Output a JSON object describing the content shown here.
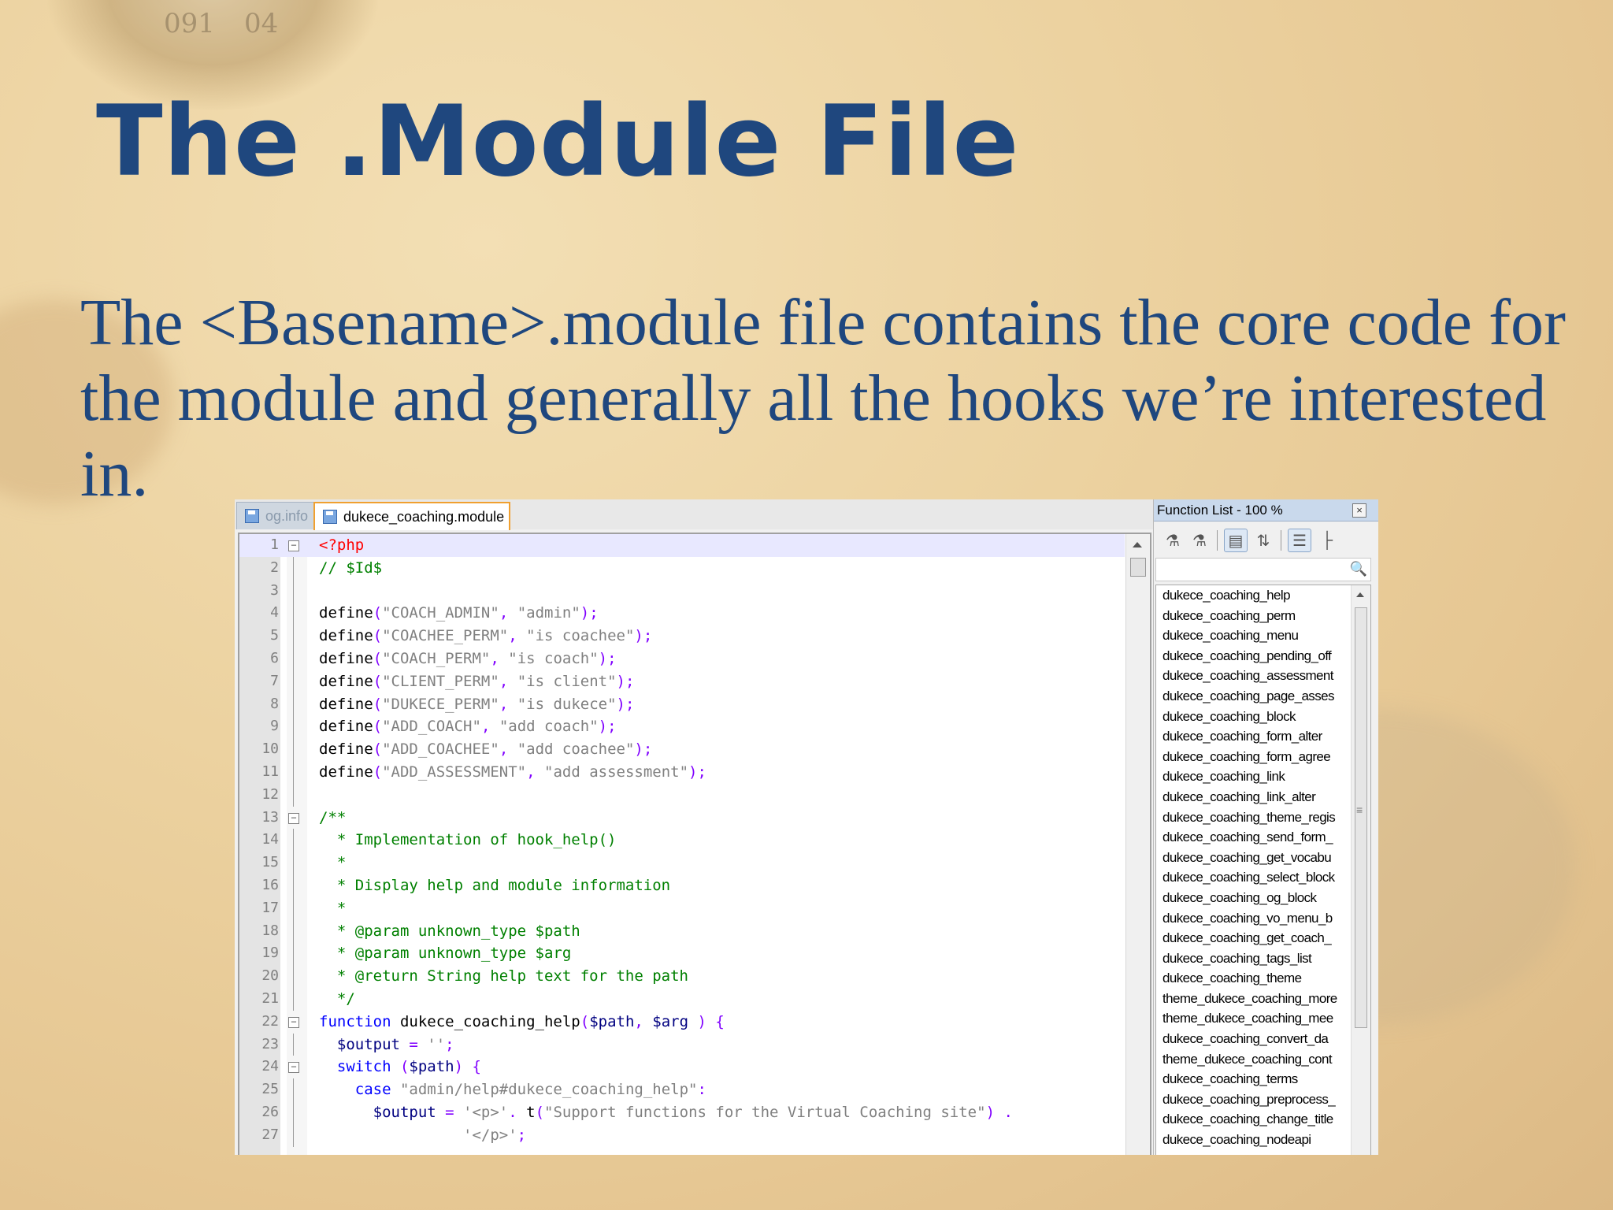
{
  "slide": {
    "title": "The .Module File",
    "body": "The <Basename>.module file contains the core code for the module and generally all the hooks we’re interested in.",
    "background_digits": [
      "091",
      "04"
    ]
  },
  "editor": {
    "tabs": [
      {
        "label": "og.info",
        "active": false
      },
      {
        "label": "dukece_coaching.module",
        "active": true
      }
    ],
    "code_lines": [
      {
        "n": "1",
        "fold": "box",
        "segs": [
          [
            "<?php",
            "#ff0000"
          ]
        ]
      },
      {
        "n": "2",
        "fold": "line",
        "segs": [
          [
            "// $Id$",
            "#008000"
          ]
        ]
      },
      {
        "n": "3",
        "fold": "line",
        "segs": []
      },
      {
        "n": "4",
        "fold": "line",
        "segs": [
          [
            "define",
            "#000000"
          ],
          [
            "(",
            "#8000ff"
          ],
          [
            "\"COACH_ADMIN\"",
            "#808080"
          ],
          [
            ", ",
            "#8000ff"
          ],
          [
            "\"admin\"",
            "#808080"
          ],
          [
            ");",
            "#8000ff"
          ]
        ]
      },
      {
        "n": "5",
        "fold": "line",
        "segs": [
          [
            "define",
            "#000000"
          ],
          [
            "(",
            "#8000ff"
          ],
          [
            "\"COACHEE_PERM\"",
            "#808080"
          ],
          [
            ", ",
            "#8000ff"
          ],
          [
            "\"is coachee\"",
            "#808080"
          ],
          [
            ");",
            "#8000ff"
          ]
        ]
      },
      {
        "n": "6",
        "fold": "line",
        "segs": [
          [
            "define",
            "#000000"
          ],
          [
            "(",
            "#8000ff"
          ],
          [
            "\"COACH_PERM\"",
            "#808080"
          ],
          [
            ", ",
            "#8000ff"
          ],
          [
            "\"is coach\"",
            "#808080"
          ],
          [
            ");",
            "#8000ff"
          ]
        ]
      },
      {
        "n": "7",
        "fold": "line",
        "segs": [
          [
            "define",
            "#000000"
          ],
          [
            "(",
            "#8000ff"
          ],
          [
            "\"CLIENT_PERM\"",
            "#808080"
          ],
          [
            ", ",
            "#8000ff"
          ],
          [
            "\"is client\"",
            "#808080"
          ],
          [
            ");",
            "#8000ff"
          ]
        ]
      },
      {
        "n": "8",
        "fold": "line",
        "segs": [
          [
            "define",
            "#000000"
          ],
          [
            "(",
            "#8000ff"
          ],
          [
            "\"DUKECE_PERM\"",
            "#808080"
          ],
          [
            ", ",
            "#8000ff"
          ],
          [
            "\"is dukece\"",
            "#808080"
          ],
          [
            ");",
            "#8000ff"
          ]
        ]
      },
      {
        "n": "9",
        "fold": "line",
        "segs": [
          [
            "define",
            "#000000"
          ],
          [
            "(",
            "#8000ff"
          ],
          [
            "\"ADD_COACH\"",
            "#808080"
          ],
          [
            ", ",
            "#8000ff"
          ],
          [
            "\"add coach\"",
            "#808080"
          ],
          [
            ");",
            "#8000ff"
          ]
        ]
      },
      {
        "n": "10",
        "fold": "line",
        "segs": [
          [
            "define",
            "#000000"
          ],
          [
            "(",
            "#8000ff"
          ],
          [
            "\"ADD_COACHEE\"",
            "#808080"
          ],
          [
            ", ",
            "#8000ff"
          ],
          [
            "\"add coachee\"",
            "#808080"
          ],
          [
            ");",
            "#8000ff"
          ]
        ]
      },
      {
        "n": "11",
        "fold": "line",
        "segs": [
          [
            "define",
            "#000000"
          ],
          [
            "(",
            "#8000ff"
          ],
          [
            "\"ADD_ASSESSMENT\"",
            "#808080"
          ],
          [
            ", ",
            "#8000ff"
          ],
          [
            "\"add assessment\"",
            "#808080"
          ],
          [
            ");",
            "#8000ff"
          ]
        ]
      },
      {
        "n": "12",
        "fold": "line",
        "segs": []
      },
      {
        "n": "13",
        "fold": "box",
        "segs": [
          [
            "/**",
            "#008000"
          ]
        ]
      },
      {
        "n": "14",
        "fold": "line",
        "segs": [
          [
            "  * Implementation of hook_help()",
            "#008000"
          ]
        ]
      },
      {
        "n": "15",
        "fold": "line",
        "segs": [
          [
            "  *",
            "#008000"
          ]
        ]
      },
      {
        "n": "16",
        "fold": "line",
        "segs": [
          [
            "  * Display help and module information",
            "#008000"
          ]
        ]
      },
      {
        "n": "17",
        "fold": "line",
        "segs": [
          [
            "  *",
            "#008000"
          ]
        ]
      },
      {
        "n": "18",
        "fold": "line",
        "segs": [
          [
            "  * @param unknown_type $path",
            "#008000"
          ]
        ]
      },
      {
        "n": "19",
        "fold": "line",
        "segs": [
          [
            "  * @param unknown_type $arg",
            "#008000"
          ]
        ]
      },
      {
        "n": "20",
        "fold": "line",
        "segs": [
          [
            "  * @return String help text for the path",
            "#008000"
          ]
        ]
      },
      {
        "n": "21",
        "fold": "line",
        "segs": [
          [
            "  */",
            "#008000"
          ]
        ]
      },
      {
        "n": "22",
        "fold": "box",
        "segs": [
          [
            "function",
            "#0000ff"
          ],
          [
            " dukece_coaching_help",
            "#000000"
          ],
          [
            "(",
            "#8000ff"
          ],
          [
            "$path",
            "#000080"
          ],
          [
            ", ",
            "#8000ff"
          ],
          [
            "$arg",
            "#000080"
          ],
          [
            " ) {",
            "#8000ff"
          ]
        ]
      },
      {
        "n": "23",
        "fold": "line",
        "segs": [
          [
            "  $output",
            "#000080"
          ],
          [
            " = ",
            "#8000ff"
          ],
          [
            "''",
            "#808080"
          ],
          [
            ";",
            "#8000ff"
          ]
        ]
      },
      {
        "n": "24",
        "fold": "box",
        "segs": [
          [
            "  switch",
            "#0000ff"
          ],
          [
            " (",
            "#8000ff"
          ],
          [
            "$path",
            "#000080"
          ],
          [
            ") {",
            "#8000ff"
          ]
        ]
      },
      {
        "n": "25",
        "fold": "line",
        "segs": [
          [
            "    case",
            "#0000ff"
          ],
          [
            " ",
            "#000000"
          ],
          [
            "\"admin/help#dukece_coaching_help\"",
            "#808080"
          ],
          [
            ":",
            "#8000ff"
          ]
        ]
      },
      {
        "n": "26",
        "fold": "line",
        "segs": [
          [
            "      $output",
            "#000080"
          ],
          [
            " = ",
            "#8000ff"
          ],
          [
            "'<p>'",
            "#808080"
          ],
          [
            ". ",
            "#8000ff"
          ],
          [
            "t",
            "#000000"
          ],
          [
            "(",
            "#8000ff"
          ],
          [
            "\"Support functions for the Virtual Coaching site\"",
            "#808080"
          ],
          [
            ") .",
            "#8000ff"
          ]
        ]
      },
      {
        "n": "27",
        "fold": "line",
        "segs": [
          [
            "                ",
            "#000000"
          ],
          [
            "'</p>'",
            "#808080"
          ],
          [
            ";",
            "#8000ff"
          ]
        ]
      }
    ]
  },
  "function_list": {
    "title": "Function List - 100 %",
    "close_label": "×",
    "items": [
      "dukece_coaching_help",
      "dukece_coaching_perm",
      "dukece_coaching_menu",
      "dukece_coaching_pending_off",
      "dukece_coaching_assessment",
      "dukece_coaching_page_asses",
      "dukece_coaching_block",
      "dukece_coaching_form_alter",
      "dukece_coaching_form_agree",
      "dukece_coaching_link",
      "dukece_coaching_link_alter",
      "dukece_coaching_theme_regis",
      "dukece_coaching_send_form_",
      "dukece_coaching_get_vocabu",
      "dukece_coaching_select_block",
      "dukece_coaching_og_block",
      "dukece_coaching_vo_menu_b",
      "dukece_coaching_get_coach_",
      "dukece_coaching_tags_list",
      "dukece_coaching_theme",
      "theme_dukece_coaching_more",
      "theme_dukece_coaching_mee",
      "dukece_coaching_convert_da",
      "theme_dukece_coaching_cont",
      "dukece_coaching_terms",
      "dukece_coaching_preprocess_",
      "dukece_coaching_change_title",
      "dukece_coaching_nodeapi"
    ]
  },
  "colors": {
    "title": "#1f477e",
    "body_text": "#1f477e",
    "active_tab_border": "#f0a030",
    "current_line": "#e8e8ff"
  }
}
